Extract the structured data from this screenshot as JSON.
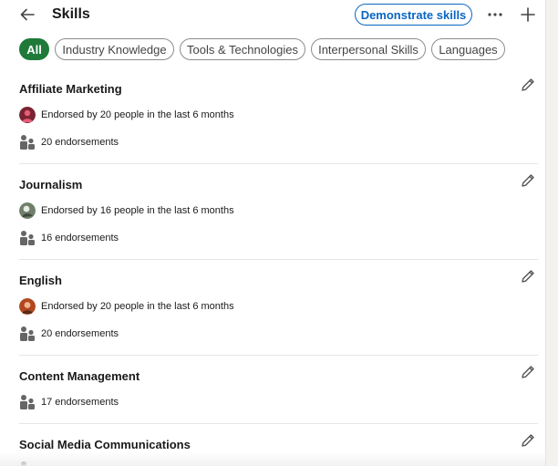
{
  "header": {
    "title": "Skills",
    "demonstrate_label": "Demonstrate skills"
  },
  "filters": [
    {
      "label": "All",
      "active": true
    },
    {
      "label": "Industry Knowledge",
      "active": false
    },
    {
      "label": "Tools & Technologies",
      "active": false
    },
    {
      "label": "Interpersonal Skills",
      "active": false
    },
    {
      "label": "Languages",
      "active": false
    }
  ],
  "skills": [
    {
      "name": "Affiliate Marketing",
      "endorsed_by": "Endorsed by 20 people in the last 6 months",
      "endorsements": "20 endorsements"
    },
    {
      "name": "Journalism",
      "endorsed_by": "Endorsed by 16 people in the last 6 months",
      "endorsements": "16 endorsements"
    },
    {
      "name": "English",
      "endorsed_by": "Endorsed by 20 people in the last 6 months",
      "endorsements": "20 endorsements"
    },
    {
      "name": "Content Management",
      "endorsements": "17 endorsements"
    },
    {
      "name": "Social Media Communications"
    }
  ],
  "colors": {
    "accent": "#0a66c2",
    "active_filter": "#1f7a3a"
  },
  "icons": {
    "back": "arrow-left-icon",
    "more": "more-horizontal-icon",
    "add": "plus-icon",
    "edit": "pencil-icon",
    "endorsements": "people-icon"
  }
}
